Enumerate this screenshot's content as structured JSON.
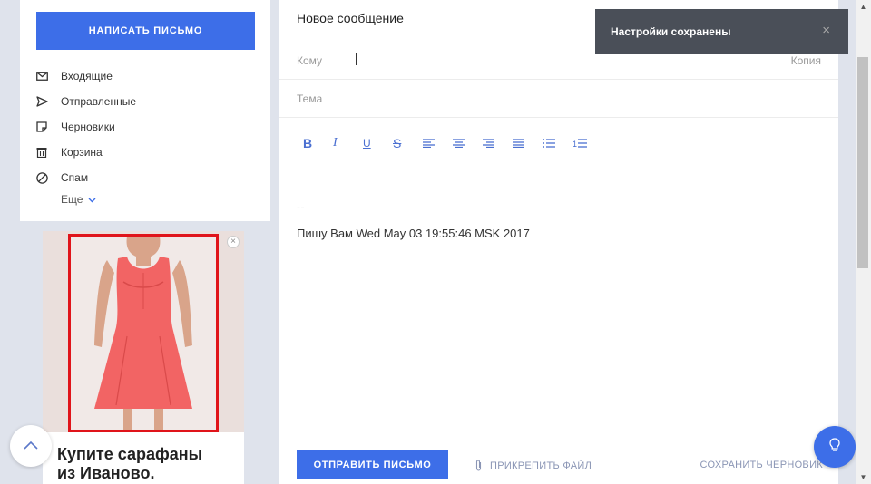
{
  "sidebar": {
    "compose_label": "НАПИСАТЬ ПИСЬМО",
    "folders": [
      {
        "label": "Входящие",
        "icon": "envelope-icon"
      },
      {
        "label": "Отправленные",
        "icon": "send-arrow-icon"
      },
      {
        "label": "Черновики",
        "icon": "draft-doc-icon"
      },
      {
        "label": "Корзина",
        "icon": "trash-icon"
      },
      {
        "label": "Спам",
        "icon": "spam-block-icon"
      }
    ],
    "more_label": "Еще"
  },
  "ad": {
    "headline": "Купите сарафаны из Иваново.",
    "frame_color": "#e0141a",
    "dress_color": "#f26464"
  },
  "compose": {
    "title": "Новое сообщение",
    "to_label": "Кому",
    "cc_label": "Копия",
    "subject_label": "Тема",
    "signature_dash": "--",
    "signature_text": "Пишу Вам Wed May 03 19:55:46 MSK 2017",
    "send_label": "ОТПРАВИТЬ ПИСЬМО",
    "attach_label": "ПРИКРЕПИТЬ ФАЙЛ",
    "save_draft_label": "СОХРАНИТЬ ЧЕРНОВИК"
  },
  "toolbar": {
    "bold": "B",
    "italic": "I",
    "underline": "U",
    "strike": "S",
    "tools": [
      "bold-icon",
      "italic-icon",
      "underline-icon",
      "strikethrough-icon",
      "align-left-icon",
      "align-center-icon",
      "align-right-icon",
      "align-justify-icon",
      "bullet-list-icon",
      "numbered-list-icon"
    ]
  },
  "toast": {
    "text": "Настройки сохранены"
  },
  "colors": {
    "accent": "#3d6ee8",
    "toast_bg": "#4a4f58",
    "page_bg": "#dfe3ec"
  }
}
